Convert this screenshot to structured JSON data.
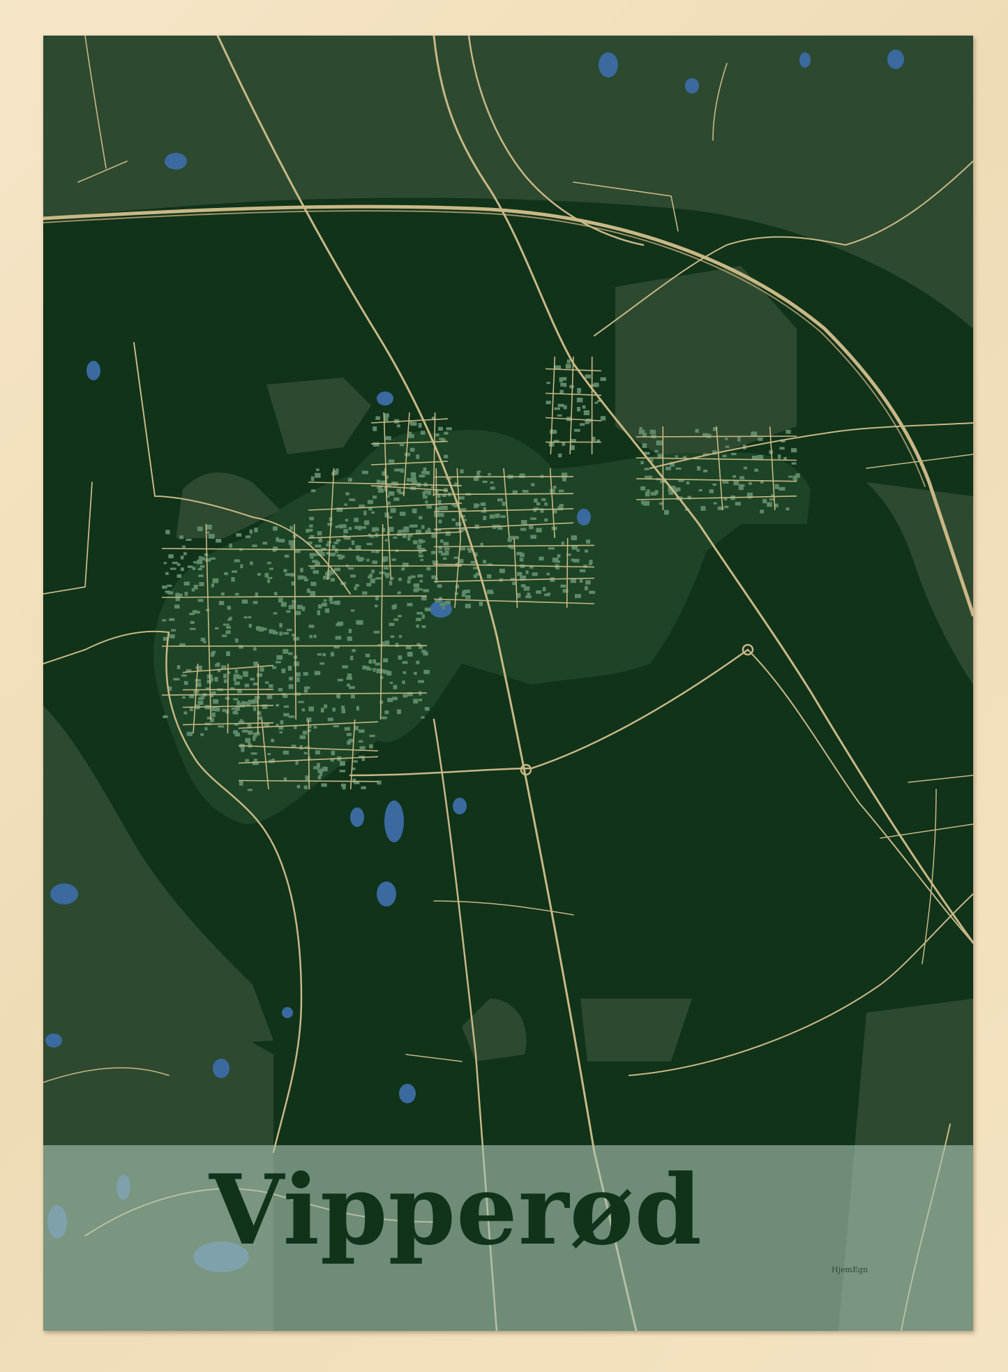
{
  "poster": {
    "title": "Vipperød",
    "brand": "HjemEgn"
  },
  "colors": {
    "frame": "#f1dfbf",
    "land_dark": "#10331a",
    "land_light": "#2d4a30",
    "road": "#c9b886",
    "water": "#3a6aa0",
    "buildings": "#5f8a6a",
    "title_band": "#aac3b2",
    "title_text": "#10331a"
  }
}
